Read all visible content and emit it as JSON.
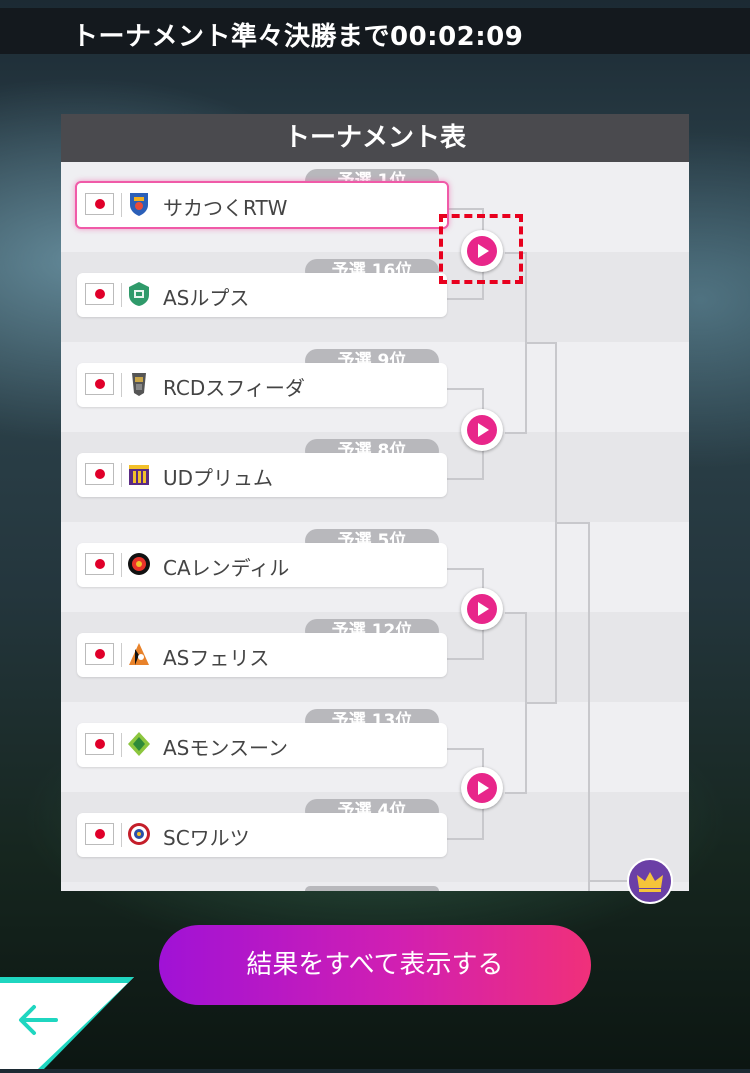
{
  "header": {
    "countdown_text": "トーナメント準々決勝まで00:02:09"
  },
  "panel": {
    "title": "トーナメント表"
  },
  "teams": [
    {
      "rank": "予選 1位",
      "name": "サカつくRTW",
      "selected": true
    },
    {
      "rank": "予選 16位",
      "name": "ASルプス"
    },
    {
      "rank": "予選 9位",
      "name": "RCDスフィーダ"
    },
    {
      "rank": "予選 8位",
      "name": "UDプリュム"
    },
    {
      "rank": "予選 5位",
      "name": "CAレンディル"
    },
    {
      "rank": "予選 12位",
      "name": "ASフェリス"
    },
    {
      "rank": "予選 13位",
      "name": "ASモンスーン"
    },
    {
      "rank": "予選 4位",
      "name": "SCワルツ"
    }
  ],
  "icons": {
    "play": "play-icon",
    "flag": "japan-flag-icon",
    "crown": "crown-icon",
    "back": "left-arrow-icon"
  },
  "colors": {
    "accent_pink": "#e8268a",
    "highlight_red": "#e8001e",
    "button_gradient_start": "#a012d6",
    "button_gradient_end": "#f0307a"
  },
  "actions": {
    "show_all_label": "結果をすべて表示する"
  }
}
